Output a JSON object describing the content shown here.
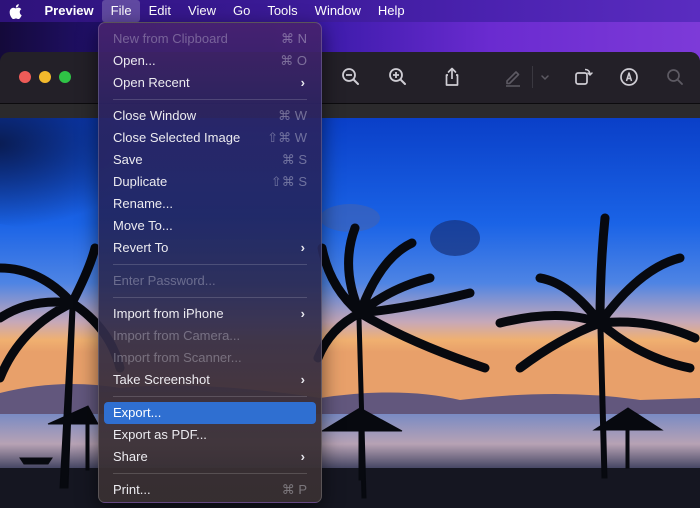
{
  "menubar": {
    "apple_icon": "apple-logo-icon",
    "app_name": "Preview",
    "items": [
      "File",
      "Edit",
      "View",
      "Go",
      "Tools",
      "Window",
      "Help"
    ],
    "active": "File"
  },
  "window": {
    "traffic_lights": [
      "close",
      "minimize",
      "zoom"
    ],
    "toolbar_icons": [
      "zoom-out-icon",
      "zoom-in-icon",
      "share-icon",
      "markup-pen-icon",
      "chevron-down-icon",
      "rotate-icon",
      "annotate-icon",
      "search-icon"
    ]
  },
  "photo": {
    "description": "Tropical beach at sunset with palm tree silhouettes and thatched umbrellas"
  },
  "file_menu": {
    "items": [
      {
        "label": "New from Clipboard",
        "shortcut": "⌘ N",
        "disabled": true
      },
      {
        "label": "Open...",
        "shortcut": "⌘ O"
      },
      {
        "label": "Open Recent",
        "submenu": true
      },
      {
        "separator": true
      },
      {
        "label": "Close Window",
        "shortcut": "⌘ W"
      },
      {
        "label": "Close Selected Image",
        "shortcut": "⇧⌘ W"
      },
      {
        "label": "Save",
        "shortcut": "⌘ S"
      },
      {
        "label": "Duplicate",
        "shortcut": "⇧⌘ S"
      },
      {
        "label": "Rename..."
      },
      {
        "label": "Move To..."
      },
      {
        "label": "Revert To",
        "submenu": true
      },
      {
        "separator": true
      },
      {
        "label": "Enter Password...",
        "disabled": true
      },
      {
        "separator": true
      },
      {
        "label": "Import from iPhone",
        "submenu": true
      },
      {
        "label": "Import from Camera...",
        "disabled": true
      },
      {
        "label": "Import from Scanner...",
        "disabled": true
      },
      {
        "label": "Take Screenshot",
        "submenu": true
      },
      {
        "separator": true
      },
      {
        "label": "Export...",
        "highlighted": true
      },
      {
        "label": "Export as PDF..."
      },
      {
        "label": "Share",
        "submenu": true
      },
      {
        "separator": true
      },
      {
        "label": "Print...",
        "shortcut": "⌘ P"
      }
    ],
    "submenu_glyph": "›"
  }
}
